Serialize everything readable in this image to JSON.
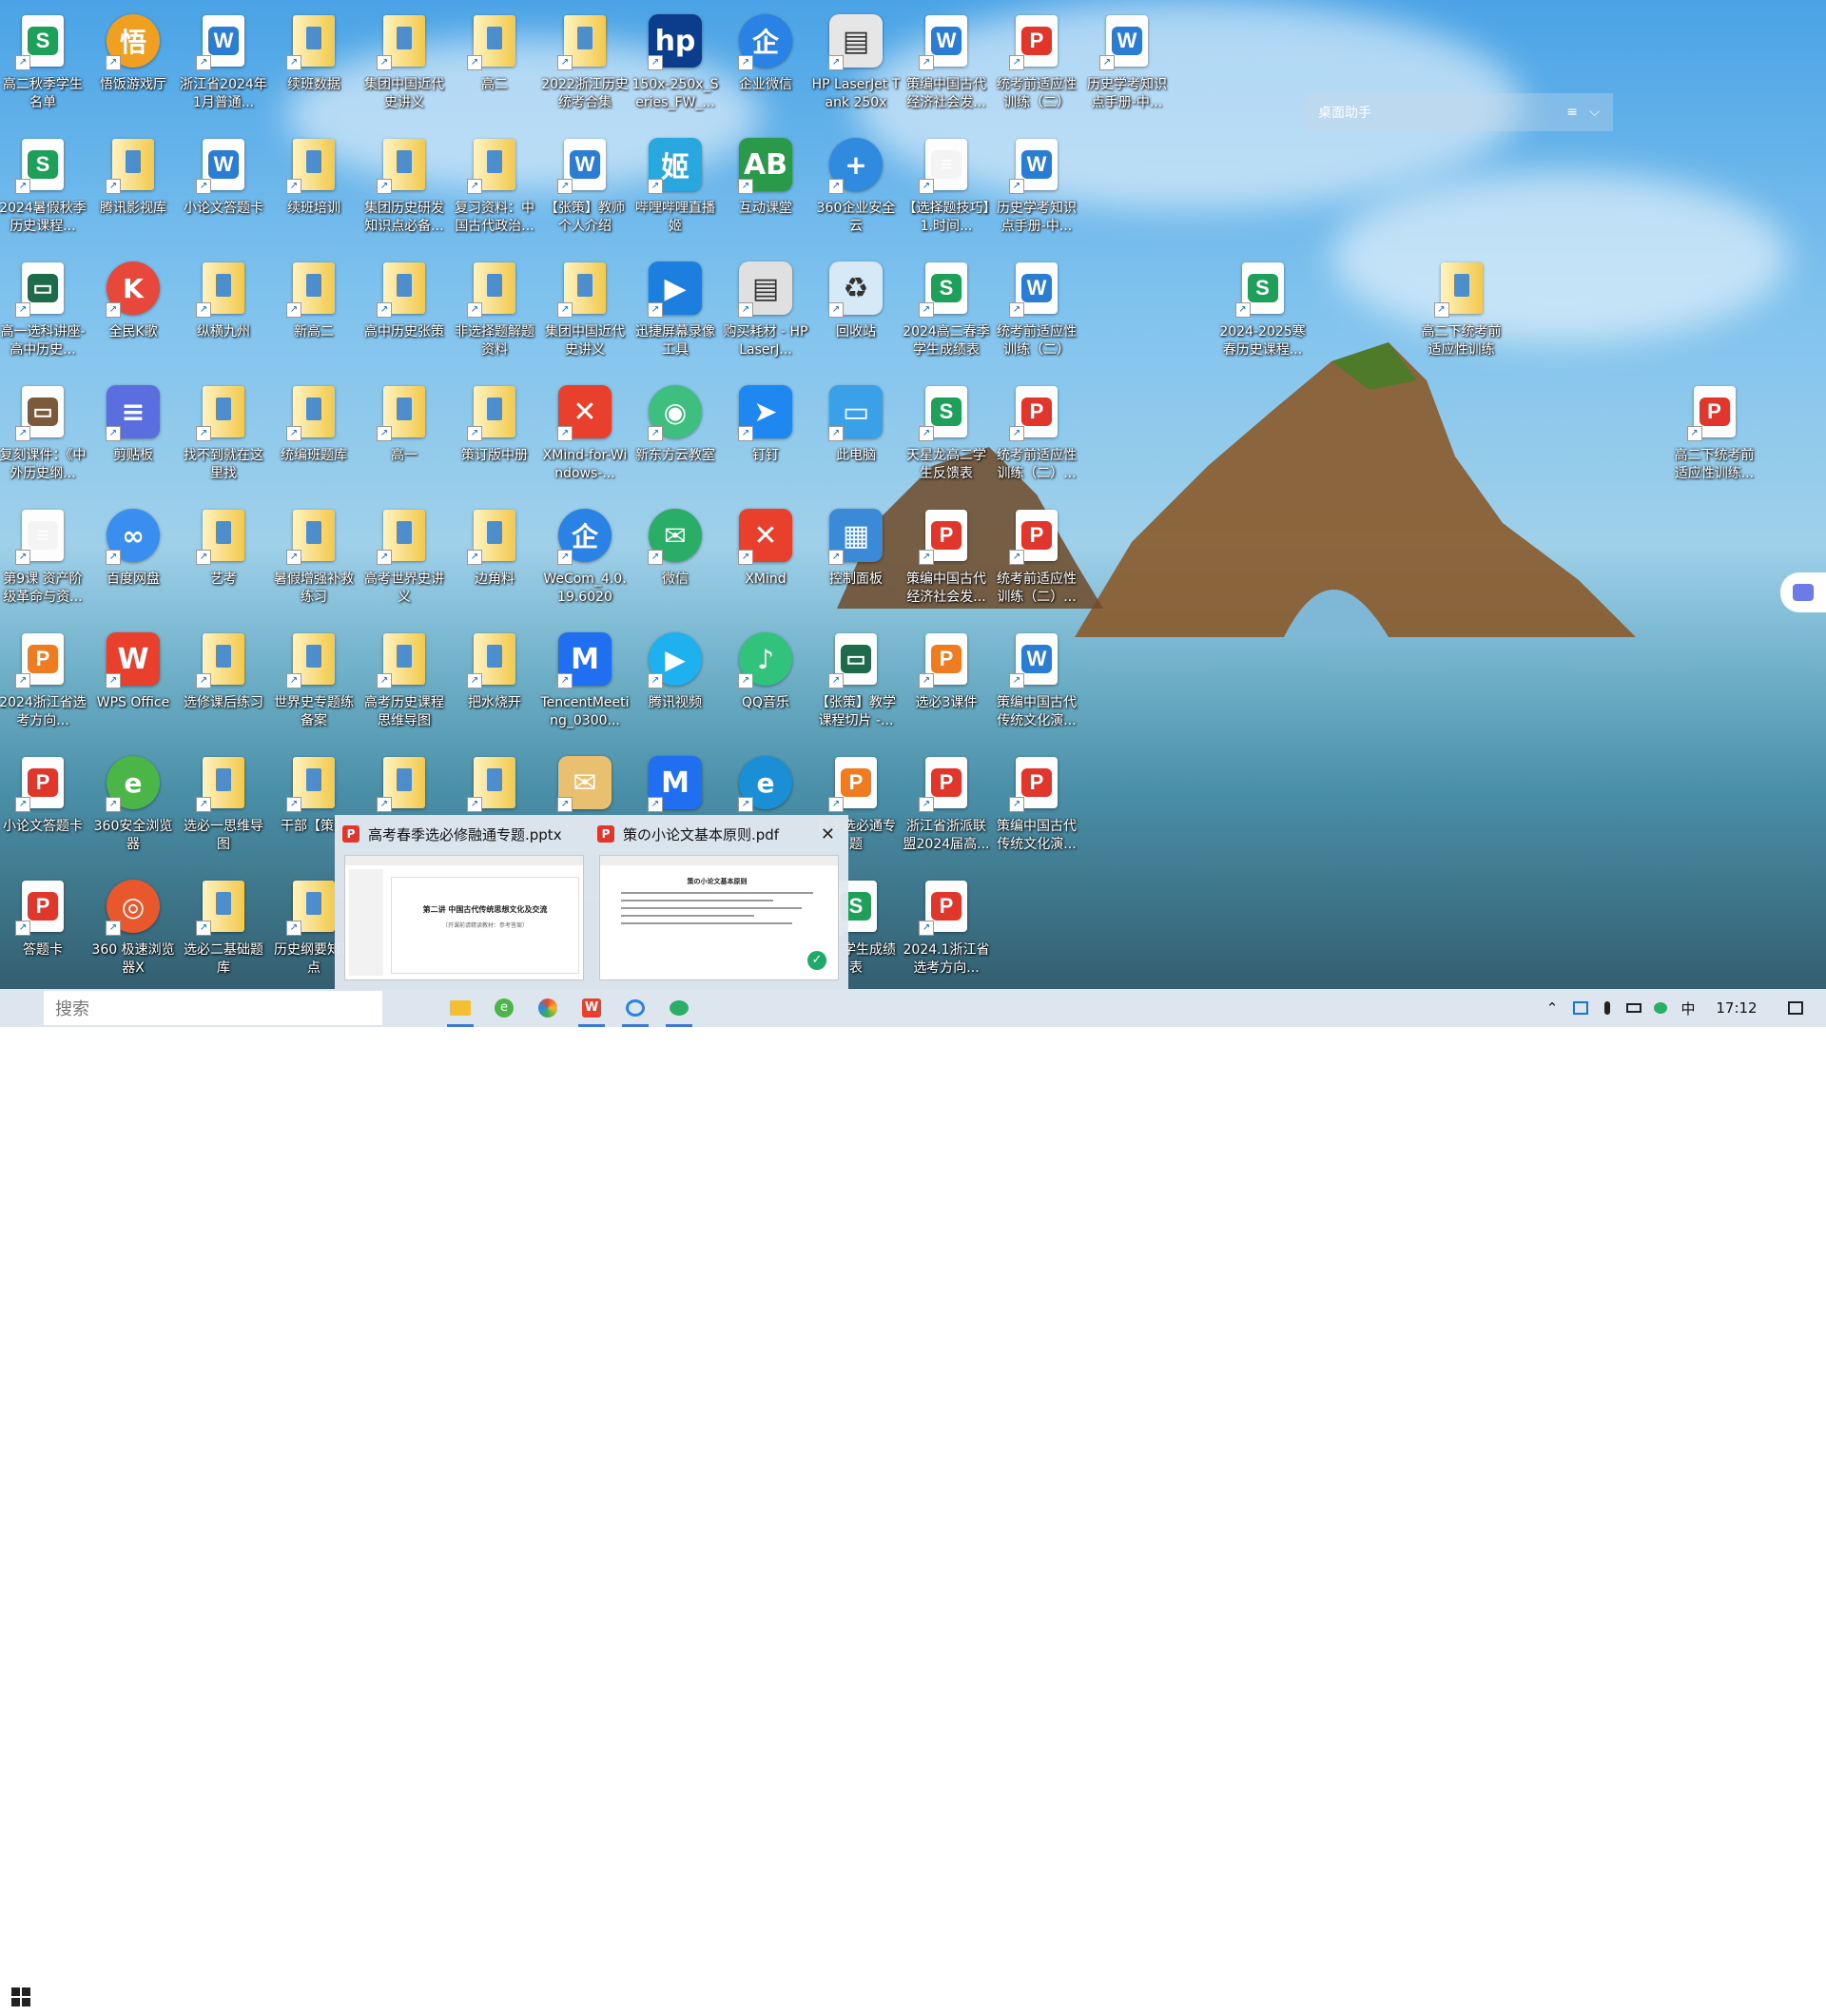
{
  "desktop": {
    "icons": [
      {
        "label": "高二秋季学生名单",
        "type": "sheet",
        "color": "#1fa05a",
        "letter": "S"
      },
      {
        "label": "悟饭游戏厅",
        "type": "round",
        "color": "#f0a020",
        "letter": "悟"
      },
      {
        "label": "浙江省2024年1月普通...",
        "type": "sheet",
        "color": "#2b7cd3",
        "letter": "W"
      },
      {
        "label": "续班数据",
        "type": "folder"
      },
      {
        "label": "集团中国近代史讲义",
        "type": "folder"
      },
      {
        "label": "高二",
        "type": "folder"
      },
      {
        "label": "2022浙江历史统考合集",
        "type": "folder"
      },
      {
        "label": "150x-250x_Series_FW_...",
        "type": "square",
        "color": "#0c3d8c",
        "letter": "hp"
      },
      {
        "label": "企业微信",
        "type": "round",
        "color": "#2a82e4",
        "letter": "企"
      },
      {
        "label": "HP LaserJet Tank 250x",
        "type": "square",
        "color": "#e6e6e6",
        "letter": "▤"
      },
      {
        "label": "策编中国古代经济社会发...",
        "type": "sheet",
        "color": "#2b7cd3",
        "letter": "W"
      },
      {
        "label": "统考前适应性训练（二）",
        "type": "sheet",
        "color": "#e0362c",
        "letter": "P"
      },
      {
        "label": "历史学考知识点手册-中...",
        "type": "sheet",
        "color": "#2b7cd3",
        "letter": "W"
      },
      {
        "label": "2024暑假秋季历史课程...",
        "type": "sheet",
        "color": "#1fa05a",
        "letter": "S"
      },
      {
        "label": "腾讯影视库",
        "type": "folder"
      },
      {
        "label": "小论文答题卡",
        "type": "sheet",
        "color": "#2b7cd3",
        "letter": "W"
      },
      {
        "label": "续班培训",
        "type": "folder"
      },
      {
        "label": "集团历史研发知识点必备...",
        "type": "folder"
      },
      {
        "label": "复习资料：中国古代政治...",
        "type": "folder"
      },
      {
        "label": "【张策】教师个人介绍",
        "type": "sheet",
        "color": "#2b7cd3",
        "letter": "W"
      },
      {
        "label": "哔哩哔哩直播姬",
        "type": "square",
        "color": "#29a8e0",
        "letter": "姬"
      },
      {
        "label": "互动课堂",
        "type": "square",
        "color": "#2a9a4a",
        "letter": "AB"
      },
      {
        "label": "360企业安全云",
        "type": "round",
        "color": "#2f8ae0",
        "letter": "+"
      },
      {
        "label": "【选择题技巧】1.时间...",
        "type": "sheet",
        "color": "#f4f4f4",
        "letter": "≡"
      },
      {
        "label": "历史学考知识点手册-中...",
        "type": "sheet",
        "color": "#2b7cd3",
        "letter": "W"
      },
      {
        "label": "高一选科讲座-高中历史...",
        "type": "sheet",
        "color": "#1d6b4a",
        "letter": "▭"
      },
      {
        "label": "全民K歌",
        "type": "round",
        "color": "#e8473c",
        "letter": "K"
      },
      {
        "label": "纵横九州",
        "type": "folder"
      },
      {
        "label": "新高二",
        "type": "folder"
      },
      {
        "label": "高中历史张策",
        "type": "folder"
      },
      {
        "label": "非选择题解题资料",
        "type": "folder"
      },
      {
        "label": "集团中国近代史讲义",
        "type": "folder"
      },
      {
        "label": "迅捷屏幕录像工具",
        "type": "square",
        "color": "#1c7fe0",
        "letter": "▶"
      },
      {
        "label": "购买耗材 - HP LaserJ...",
        "type": "square",
        "color": "#e0e0e0",
        "letter": "▤"
      },
      {
        "label": "回收站",
        "type": "square",
        "color": "#d5e9f7",
        "letter": "♻"
      },
      {
        "label": "2024高二春季学生成绩表",
        "type": "sheet",
        "color": "#1fa05a",
        "letter": "S"
      },
      {
        "label": "统考前适应性训练（二）",
        "type": "sheet",
        "color": "#2b7cd3",
        "letter": "W"
      },
      {
        "label": "2024-2025寒春历史课程...",
        "type": "sheet",
        "color": "#1fa05a",
        "letter": "S"
      },
      {
        "label": "高二下统考前适应性训练",
        "type": "folder"
      },
      {
        "label": "复刻课件：《中外历史纲...",
        "type": "sheet",
        "color": "#7a5a3a",
        "letter": "▭"
      },
      {
        "label": "剪贴板",
        "type": "square",
        "color": "#5a6ee0",
        "letter": "≡"
      },
      {
        "label": "找不到就在这里找",
        "type": "folder"
      },
      {
        "label": "统编班题库",
        "type": "folder"
      },
      {
        "label": "高一",
        "type": "folder"
      },
      {
        "label": "策订版中册",
        "type": "folder"
      },
      {
        "label": "XMind-for-Windows-...",
        "type": "square",
        "color": "#e8402c",
        "letter": "✕"
      },
      {
        "label": "新东方云教室",
        "type": "round",
        "color": "#3fbf7f",
        "letter": "◉"
      },
      {
        "label": "钉钉",
        "type": "square",
        "color": "#1e88f0",
        "letter": "➤"
      },
      {
        "label": "此电脑",
        "type": "square",
        "color": "#3aa0e8",
        "letter": "▭"
      },
      {
        "label": "天星龙高二学生反馈表",
        "type": "sheet",
        "color": "#1fa05a",
        "letter": "S"
      },
      {
        "label": "统考前适应性训练（二）...",
        "type": "sheet",
        "color": "#e0362c",
        "letter": "P"
      },
      {
        "label": "高二下统考前适应性训练...",
        "type": "sheet",
        "color": "#e0362c",
        "letter": "P"
      },
      {
        "label": "第9课 资产阶级革命与资...",
        "type": "sheet",
        "color": "#f4f4f4",
        "letter": "≡"
      },
      {
        "label": "百度网盘",
        "type": "round",
        "color": "#3a8ef0",
        "letter": "∞"
      },
      {
        "label": "艺考",
        "type": "folder"
      },
      {
        "label": "暑假增强补救练习",
        "type": "folder"
      },
      {
        "label": "高考世界史讲义",
        "type": "folder"
      },
      {
        "label": "边角料",
        "type": "folder"
      },
      {
        "label": "WeCom_4.0.19.6020",
        "type": "round",
        "color": "#2a82e4",
        "letter": "企"
      },
      {
        "label": "微信",
        "type": "round",
        "color": "#2aae67",
        "letter": "✉"
      },
      {
        "label": "XMind",
        "type": "square",
        "color": "#e8402c",
        "letter": "✕"
      },
      {
        "label": "控制面板",
        "type": "square",
        "color": "#3a8ad8",
        "letter": "▦"
      },
      {
        "label": "策编中国古代经济社会发...",
        "type": "sheet",
        "color": "#e0362c",
        "letter": "P"
      },
      {
        "label": "统考前适应性训练（二）...",
        "type": "sheet",
        "color": "#e0362c",
        "letter": "P"
      },
      {
        "label": "2024浙江省选考方向...",
        "type": "sheet",
        "color": "#f07c22",
        "letter": "P"
      },
      {
        "label": "WPS Office",
        "type": "square",
        "color": "#e8402c",
        "letter": "W"
      },
      {
        "label": "选修课后练习",
        "type": "folder"
      },
      {
        "label": "世界史专题练备案",
        "type": "folder"
      },
      {
        "label": "高考历史课程思维导图",
        "type": "folder"
      },
      {
        "label": "把水烧开",
        "type": "folder"
      },
      {
        "label": "TencentMeeting_0300...",
        "type": "square",
        "color": "#1f6ff0",
        "letter": "M"
      },
      {
        "label": "腾讯视频",
        "type": "round",
        "color": "#1fb0f0",
        "letter": "▶"
      },
      {
        "label": "QQ音乐",
        "type": "round",
        "color": "#31c27c",
        "letter": "♪"
      },
      {
        "label": "【张策】教学课程切片 -...",
        "type": "sheet",
        "color": "#1d6b4a",
        "letter": "▭"
      },
      {
        "label": "选必3课件",
        "type": "sheet",
        "color": "#f07c22",
        "letter": "P"
      },
      {
        "label": "策编中国古代传统文化演...",
        "type": "sheet",
        "color": "#2b7cd3",
        "letter": "W"
      },
      {
        "label": "小论文答题卡",
        "type": "sheet",
        "color": "#e0362c",
        "letter": "P"
      },
      {
        "label": "360安全浏览器",
        "type": "round",
        "color": "#4cb548",
        "letter": "e"
      },
      {
        "label": "选必一思维导图",
        "type": "folder"
      },
      {
        "label": "干部【策】",
        "type": "folder"
      },
      {
        "label": "",
        "type": "folder"
      },
      {
        "label": "",
        "type": "folder"
      },
      {
        "label": "",
        "type": "square",
        "color": "#e8c070",
        "letter": "✉"
      },
      {
        "label": "",
        "type": "square",
        "color": "#1f6ff0",
        "letter": "M"
      },
      {
        "label": "",
        "type": "round",
        "color": "#1a8fd6",
        "letter": "e"
      },
      {
        "label": "春季选必通专题",
        "type": "sheet",
        "color": "#f07c22",
        "letter": "P"
      },
      {
        "label": "浙江省浙派联盟2024届高...",
        "type": "sheet",
        "color": "#e0362c",
        "letter": "P"
      },
      {
        "label": "策编中国古代传统文化演...",
        "type": "sheet",
        "color": "#e0362c",
        "letter": "P"
      },
      {
        "label": "答题卡",
        "type": "sheet",
        "color": "#e0362c",
        "letter": "P"
      },
      {
        "label": "360 极速浏览器X",
        "type": "round",
        "color": "#e8582c",
        "letter": "◎"
      },
      {
        "label": "选必二基础题库",
        "type": "folder"
      },
      {
        "label": "历史纲要知识点",
        "type": "folder"
      },
      {
        "label": "高二学生成绩表",
        "type": "sheet",
        "color": "#1fa05a",
        "letter": "S"
      },
      {
        "label": "2024.1浙江省选考方向...",
        "type": "sheet",
        "color": "#e0362c",
        "letter": "P"
      }
    ]
  },
  "helper": {
    "title": "桌面助手",
    "menu_icon": "≡",
    "chevron": "⌵"
  },
  "preview": {
    "items": [
      {
        "title": "高考春季选必修融通专题.pptx",
        "badge": "P",
        "slide_heading": "第二讲 中国古代传统思想文化及交流",
        "slide_sub": "（开课前请精读教材：参考答案）"
      },
      {
        "title": "策の小论文基本原则.pdf",
        "badge": "P",
        "close_label": "✕",
        "doc_heading": "策の小论文基本原则"
      }
    ]
  },
  "taskbar": {
    "search_placeholder": "搜索",
    "ime": "中",
    "time": "17:12",
    "colors": {
      "accent": "#3b78d8",
      "bg": "#dde6ee"
    }
  }
}
